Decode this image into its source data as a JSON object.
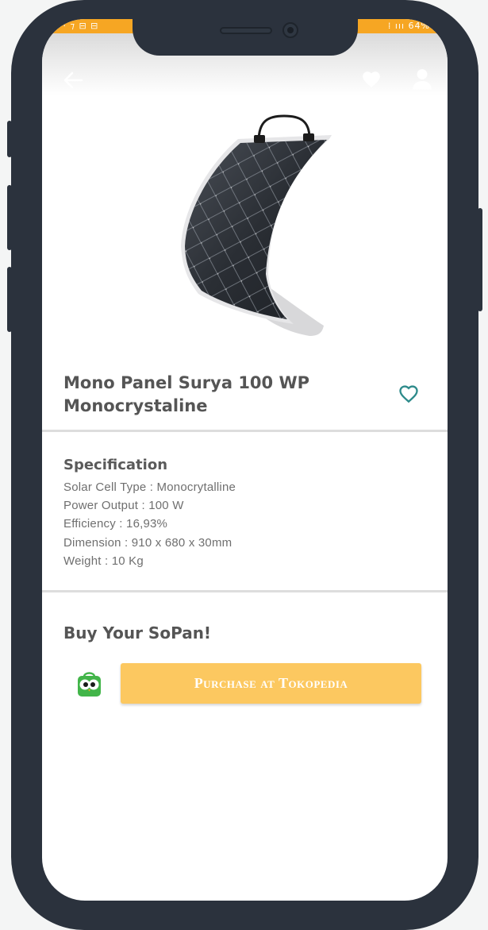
{
  "status_bar": {
    "left_text": "·· ⁊ ⊟ ⊟",
    "right_text": "⁞ ııı 64%"
  },
  "product": {
    "title_line1": "Mono Panel Surya 100 WP",
    "title_line2": "Monocrystaline",
    "image_alt": "Flexible monocrystalline solar panel"
  },
  "specification": {
    "heading": "Specification",
    "lines": [
      "Solar Cell Type : Monocrytalline",
      "Power Output : 100 W",
      "Efficiency : 16,93%",
      "Dimension : 910 x 680 x 30mm",
      "Weight : 10 Kg"
    ]
  },
  "buy": {
    "heading": "Buy Your SoPan!",
    "button_label": "Purchase at Tokopedia"
  },
  "icons": {
    "back": "arrow-left-icon",
    "favorite_top": "heart-filled-icon",
    "profile": "user-icon",
    "favorite": "heart-outline-icon",
    "store": "tokopedia-logo"
  },
  "colors": {
    "accent_orange": "#f6a623",
    "button_yellow": "#fcc860",
    "heart_teal": "#2e8b8b",
    "frame": "#2b323d"
  }
}
